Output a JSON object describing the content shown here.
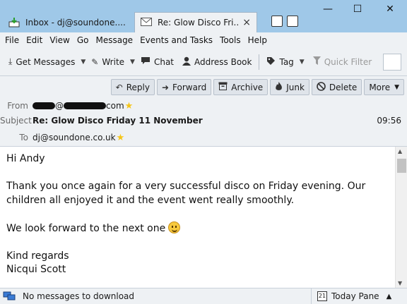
{
  "tabs": [
    {
      "label": "Inbox - dj@soundone....",
      "icon": "inbox-download-icon"
    },
    {
      "label": "Re: Glow Disco Fri...",
      "icon": "envelope-icon",
      "close": "×"
    }
  ],
  "window": {
    "minimize": "—",
    "maximize": "☐",
    "close": "✕"
  },
  "menu": [
    {
      "label": "File"
    },
    {
      "label": "Edit"
    },
    {
      "label": "View"
    },
    {
      "label": "Go"
    },
    {
      "label": "Message"
    },
    {
      "label": "Events and Tasks"
    },
    {
      "label": "Tools"
    },
    {
      "label": "Help"
    }
  ],
  "toolbar": {
    "get_messages": "Get Messages",
    "write": "Write",
    "chat": "Chat",
    "address_book": "Address Book",
    "tag": "Tag",
    "quick_filter": "Quick Filter"
  },
  "actions": {
    "reply": "Reply",
    "forward": "Forward",
    "archive": "Archive",
    "junk": "Junk",
    "delete": "Delete",
    "more": "More"
  },
  "header": {
    "from_label": "From",
    "from_value_at": "@",
    "from_value_suffix": "com",
    "subject_label": "Subject",
    "subject": "Re: Glow Disco Friday 11 November",
    "time": "09:56",
    "to_label": "To",
    "to": "dj@soundone.co.uk"
  },
  "body": {
    "greeting": "Hi Andy",
    "para1": "Thank you once again for a very successful disco on Friday evening.  Our children all enjoyed it and the event went really smoothly.",
    "para2": "We look forward to the next one",
    "signoff": "Kind regards",
    "name": "Nicqui Scott"
  },
  "status": {
    "text": "No messages to download",
    "today_pane": "Today Pane",
    "calendar_day": "21"
  },
  "colors": {
    "titlebar": "#9fc8e8",
    "chrome": "#eef1f4",
    "star": "#f5c518"
  }
}
